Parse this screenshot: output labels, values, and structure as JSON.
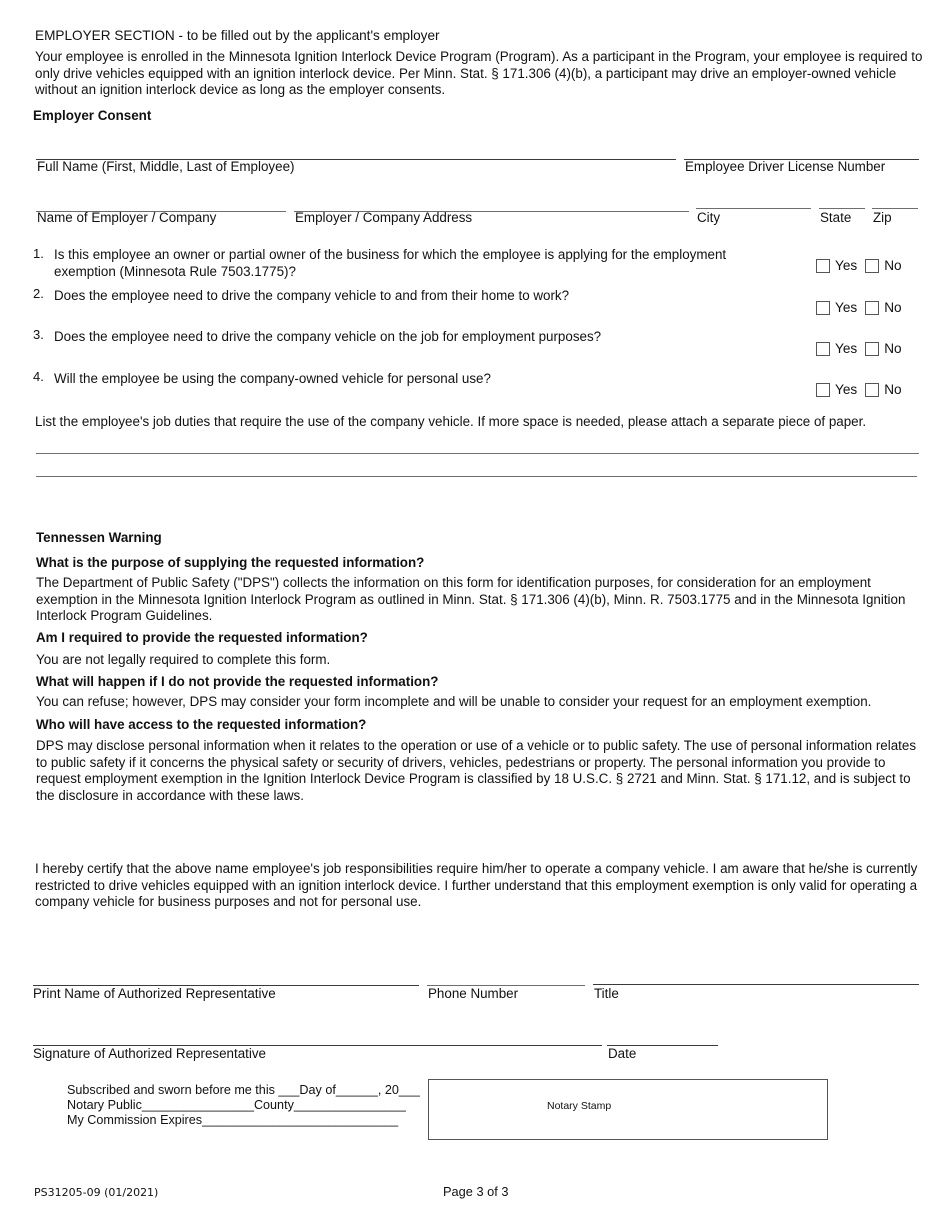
{
  "header": {
    "section_title": "EMPLOYER SECTION - to be filled out by the applicant's employer",
    "intro": "Your employee is enrolled in the Minnesota Ignition Interlock Device Program (Program).  As a participant in the Program, your employee is required to only drive vehicles equipped with an ignition interlock device.  Per Minn. Stat. § 171.306 (4)(b), a participant may drive an employer-owned vehicle without an ignition interlock device as long as the employer consents.",
    "consent_heading": "Employer Consent"
  },
  "fields": {
    "full_name": {
      "label": "Full Name (First, Middle, Last of Employee)",
      "value": ""
    },
    "license_number": {
      "label": "Employee Driver License Number",
      "value": ""
    },
    "employer_name": {
      "label": "Name of Employer / Company",
      "value": ""
    },
    "employer_address": {
      "label": "Employer / Company Address",
      "value": ""
    },
    "city": {
      "label": "City",
      "value": ""
    },
    "state": {
      "label": "State",
      "value": ""
    },
    "zip": {
      "label": "Zip",
      "value": ""
    }
  },
  "questions": [
    {
      "num": "1.",
      "text": "Is this employee an owner or partial owner of the business for which the employee is applying for the employment exemption (Minnesota Rule 7503.1775)?",
      "yes_label": "Yes",
      "no_label": "No",
      "yes_checked": false,
      "no_checked": false
    },
    {
      "num": "2.",
      "text": "Does the employee need to drive the company vehicle to and from their home to work?",
      "yes_label": "Yes",
      "no_label": "No",
      "yes_checked": false,
      "no_checked": false
    },
    {
      "num": "3.",
      "text": "Does the employee need to drive the company vehicle on the job for employment purposes?",
      "yes_label": "Yes",
      "no_label": "No",
      "yes_checked": false,
      "no_checked": false
    },
    {
      "num": "4.",
      "text": "Will the employee be using the company-owned vehicle for personal use?",
      "yes_label": "Yes",
      "no_label": "No",
      "yes_checked": false,
      "no_checked": false
    }
  ],
  "job_duties": {
    "prompt": "List the employee's job duties that require the use of the company vehicle.  If more space is needed, please attach a separate piece of paper.",
    "lines": [
      "",
      ""
    ]
  },
  "tennessen": {
    "heading": "Tennessen Warning",
    "items": [
      {
        "q": "What is the purpose of supplying the requested information?",
        "a": "The Department of Public Safety (\"DPS\") collects the information on this form for identification purposes, for consideration for an employment exemption in the Minnesota Ignition Interlock Program as outlined in Minn. Stat. § 171.306 (4)(b), Minn. R. 7503.1775 and in the Minnesota Ignition Interlock Program Guidelines."
      },
      {
        "q": "Am I required to provide the requested information?",
        "a": "You are not legally required to complete this form."
      },
      {
        "q": "What will happen if I do not provide the requested information?",
        "a": "You can refuse; however, DPS may consider your form incomplete and will be unable to consider your request for an employment exemption."
      },
      {
        "q": "Who will have access to the requested information?",
        "a": "DPS may disclose personal information when it relates to the operation or use of a vehicle or to public safety. The use of personal information relates to public safety if it concerns the physical safety or security of drivers, vehicles, pedestrians or property.  The personal information you provide to request employment exemption in the Ignition Interlock Device Program is classified by 18 U.S.C. § 2721 and Minn. Stat. § 171.12, and is subject to the disclosure in accordance with these laws."
      }
    ]
  },
  "certification": "I hereby certify that the above name employee's job responsibilities require him/her to operate a company vehicle.  I am aware that he/she is currently restricted to drive vehicles equipped with an ignition interlock device.  I further understand that this employment exemption is only valid for operating a company vehicle for business purposes and not for personal use.",
  "signature": {
    "print_name": {
      "label": "Print Name of Authorized Representative",
      "value": ""
    },
    "phone": {
      "label": "Phone Number",
      "value": ""
    },
    "title": {
      "label": "Title",
      "value": ""
    },
    "signature": {
      "label": "Signature of Authorized Representative",
      "value": ""
    },
    "date": {
      "label": "Date",
      "value": ""
    }
  },
  "notary": {
    "line1": "Subscribed and sworn before me this ___Day of______, 20___",
    "line2": "Notary Public________________County________________",
    "line3": "My Commission Expires____________________________",
    "stamp_label": "Notary Stamp"
  },
  "footer": {
    "form_code": "PS31205-09 (01/2021)",
    "page": "Page 3 of 3"
  }
}
